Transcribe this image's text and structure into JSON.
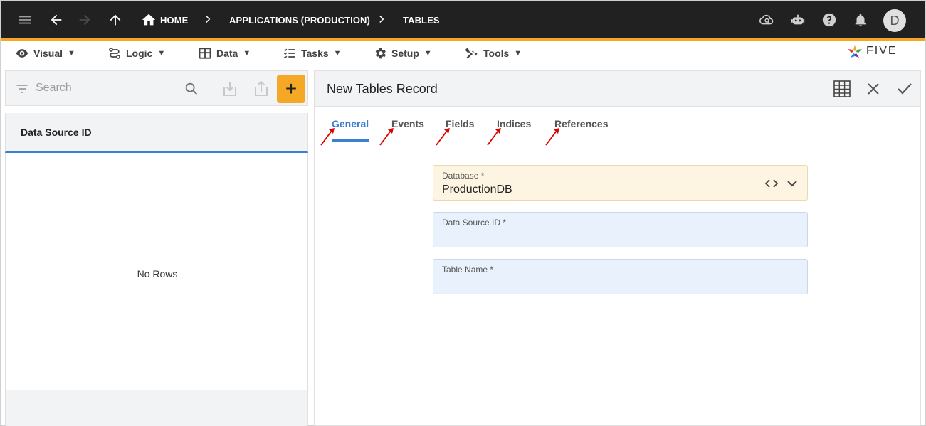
{
  "topbar": {
    "breadcrumbs": [
      "HOME",
      "APPLICATIONS (PRODUCTION)",
      "TABLES"
    ],
    "avatar_initial": "D"
  },
  "menu": {
    "items": [
      {
        "label": "Visual",
        "icon": "eye-icon"
      },
      {
        "label": "Logic",
        "icon": "flow-icon"
      },
      {
        "label": "Data",
        "icon": "table-icon"
      },
      {
        "label": "Tasks",
        "icon": "checklist-icon"
      },
      {
        "label": "Setup",
        "icon": "gear-icon"
      },
      {
        "label": "Tools",
        "icon": "tools-icon"
      }
    ],
    "caret": "▼",
    "logo_text": "FIVE"
  },
  "list": {
    "search_placeholder": "Search",
    "add_label": "+",
    "column_header": "Data Source ID",
    "empty_text": "No Rows"
  },
  "form": {
    "title": "New Tables Record",
    "tabs": [
      "General",
      "Events",
      "Fields",
      "Indices",
      "References"
    ],
    "active_tab": "General",
    "fields": [
      {
        "label": "Database *",
        "value": "ProductionDB"
      },
      {
        "label": "Data Source ID *",
        "value": ""
      },
      {
        "label": "Table Name *",
        "value": ""
      }
    ]
  },
  "colors": {
    "topbar": "#212121",
    "accent": "#f5a623",
    "primary": "#3b7fd0",
    "annotation_arrow": "#e00000"
  }
}
